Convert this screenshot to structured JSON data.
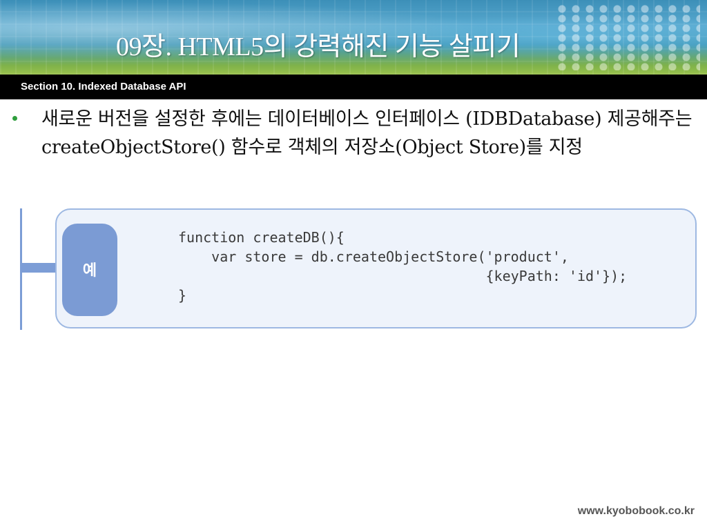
{
  "header": {
    "title": "09장. HTML5의 강력해진 기능 살피기",
    "section": "Section 10. Indexed Database API"
  },
  "content": {
    "bullet": "새로운 버전을 설정한 후에는 데이터베이스 인터페이스 (IDBDatabase) 제공해주는 createObjectStore() 함수로 객체의 저장소(Object Store)를 지정"
  },
  "example": {
    "label": "예",
    "code_lines": [
      "function createDB(){",
      "    var store = db.createObjectStore('product',",
      "                                     {keyPath: 'id'});",
      "}"
    ]
  },
  "footer": {
    "url": "www.kyobobook.co.kr"
  },
  "colors": {
    "bullet": "#2f9e3d",
    "example_accent": "#7b9bd4",
    "example_bg": "#eef3fb",
    "section_bar": "#000000"
  }
}
